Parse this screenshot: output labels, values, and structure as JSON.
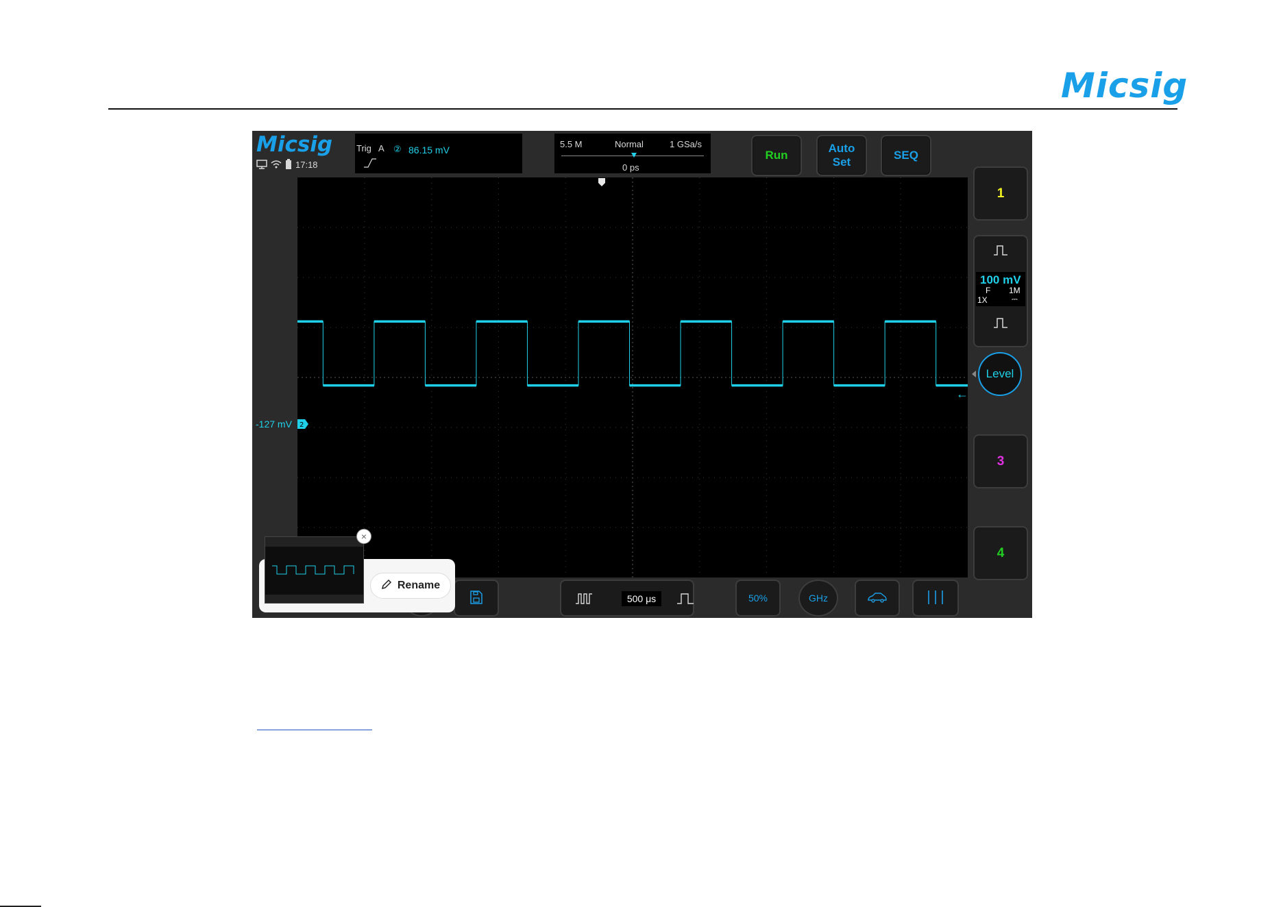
{
  "page": {
    "brand": "Micsig"
  },
  "scope": {
    "brand": "Micsig",
    "clock": "17:18",
    "trigger": {
      "label": "Trig",
      "source": "A",
      "channel": "②",
      "value": "86.15 mV"
    },
    "acquisition": {
      "memory_depth": "5.5 M",
      "mode": "Normal",
      "sample_rate": "1 GSa/s",
      "horizontal_offset": "0 ps"
    },
    "buttons": {
      "run": "Run",
      "auto_set": "Auto\nSet",
      "seq": "SEQ"
    },
    "channels": {
      "ch1": "1",
      "ch3": "3",
      "ch4": "4",
      "ch2": {
        "scale": "100 mV",
        "coupling_mode": "F",
        "impedance": "1M",
        "probe": "1X",
        "dc_symbol": "⎓",
        "offset_label": "-127 mV",
        "marker": "2",
        "color": "#1fd0e8"
      }
    },
    "level_button": "Level",
    "bottom": {
      "timebase": "500 μs",
      "half_label": "50%",
      "freq_label": "GHz"
    },
    "popup": {
      "rename_label": "Rename",
      "close_symbol": "×"
    }
  }
}
